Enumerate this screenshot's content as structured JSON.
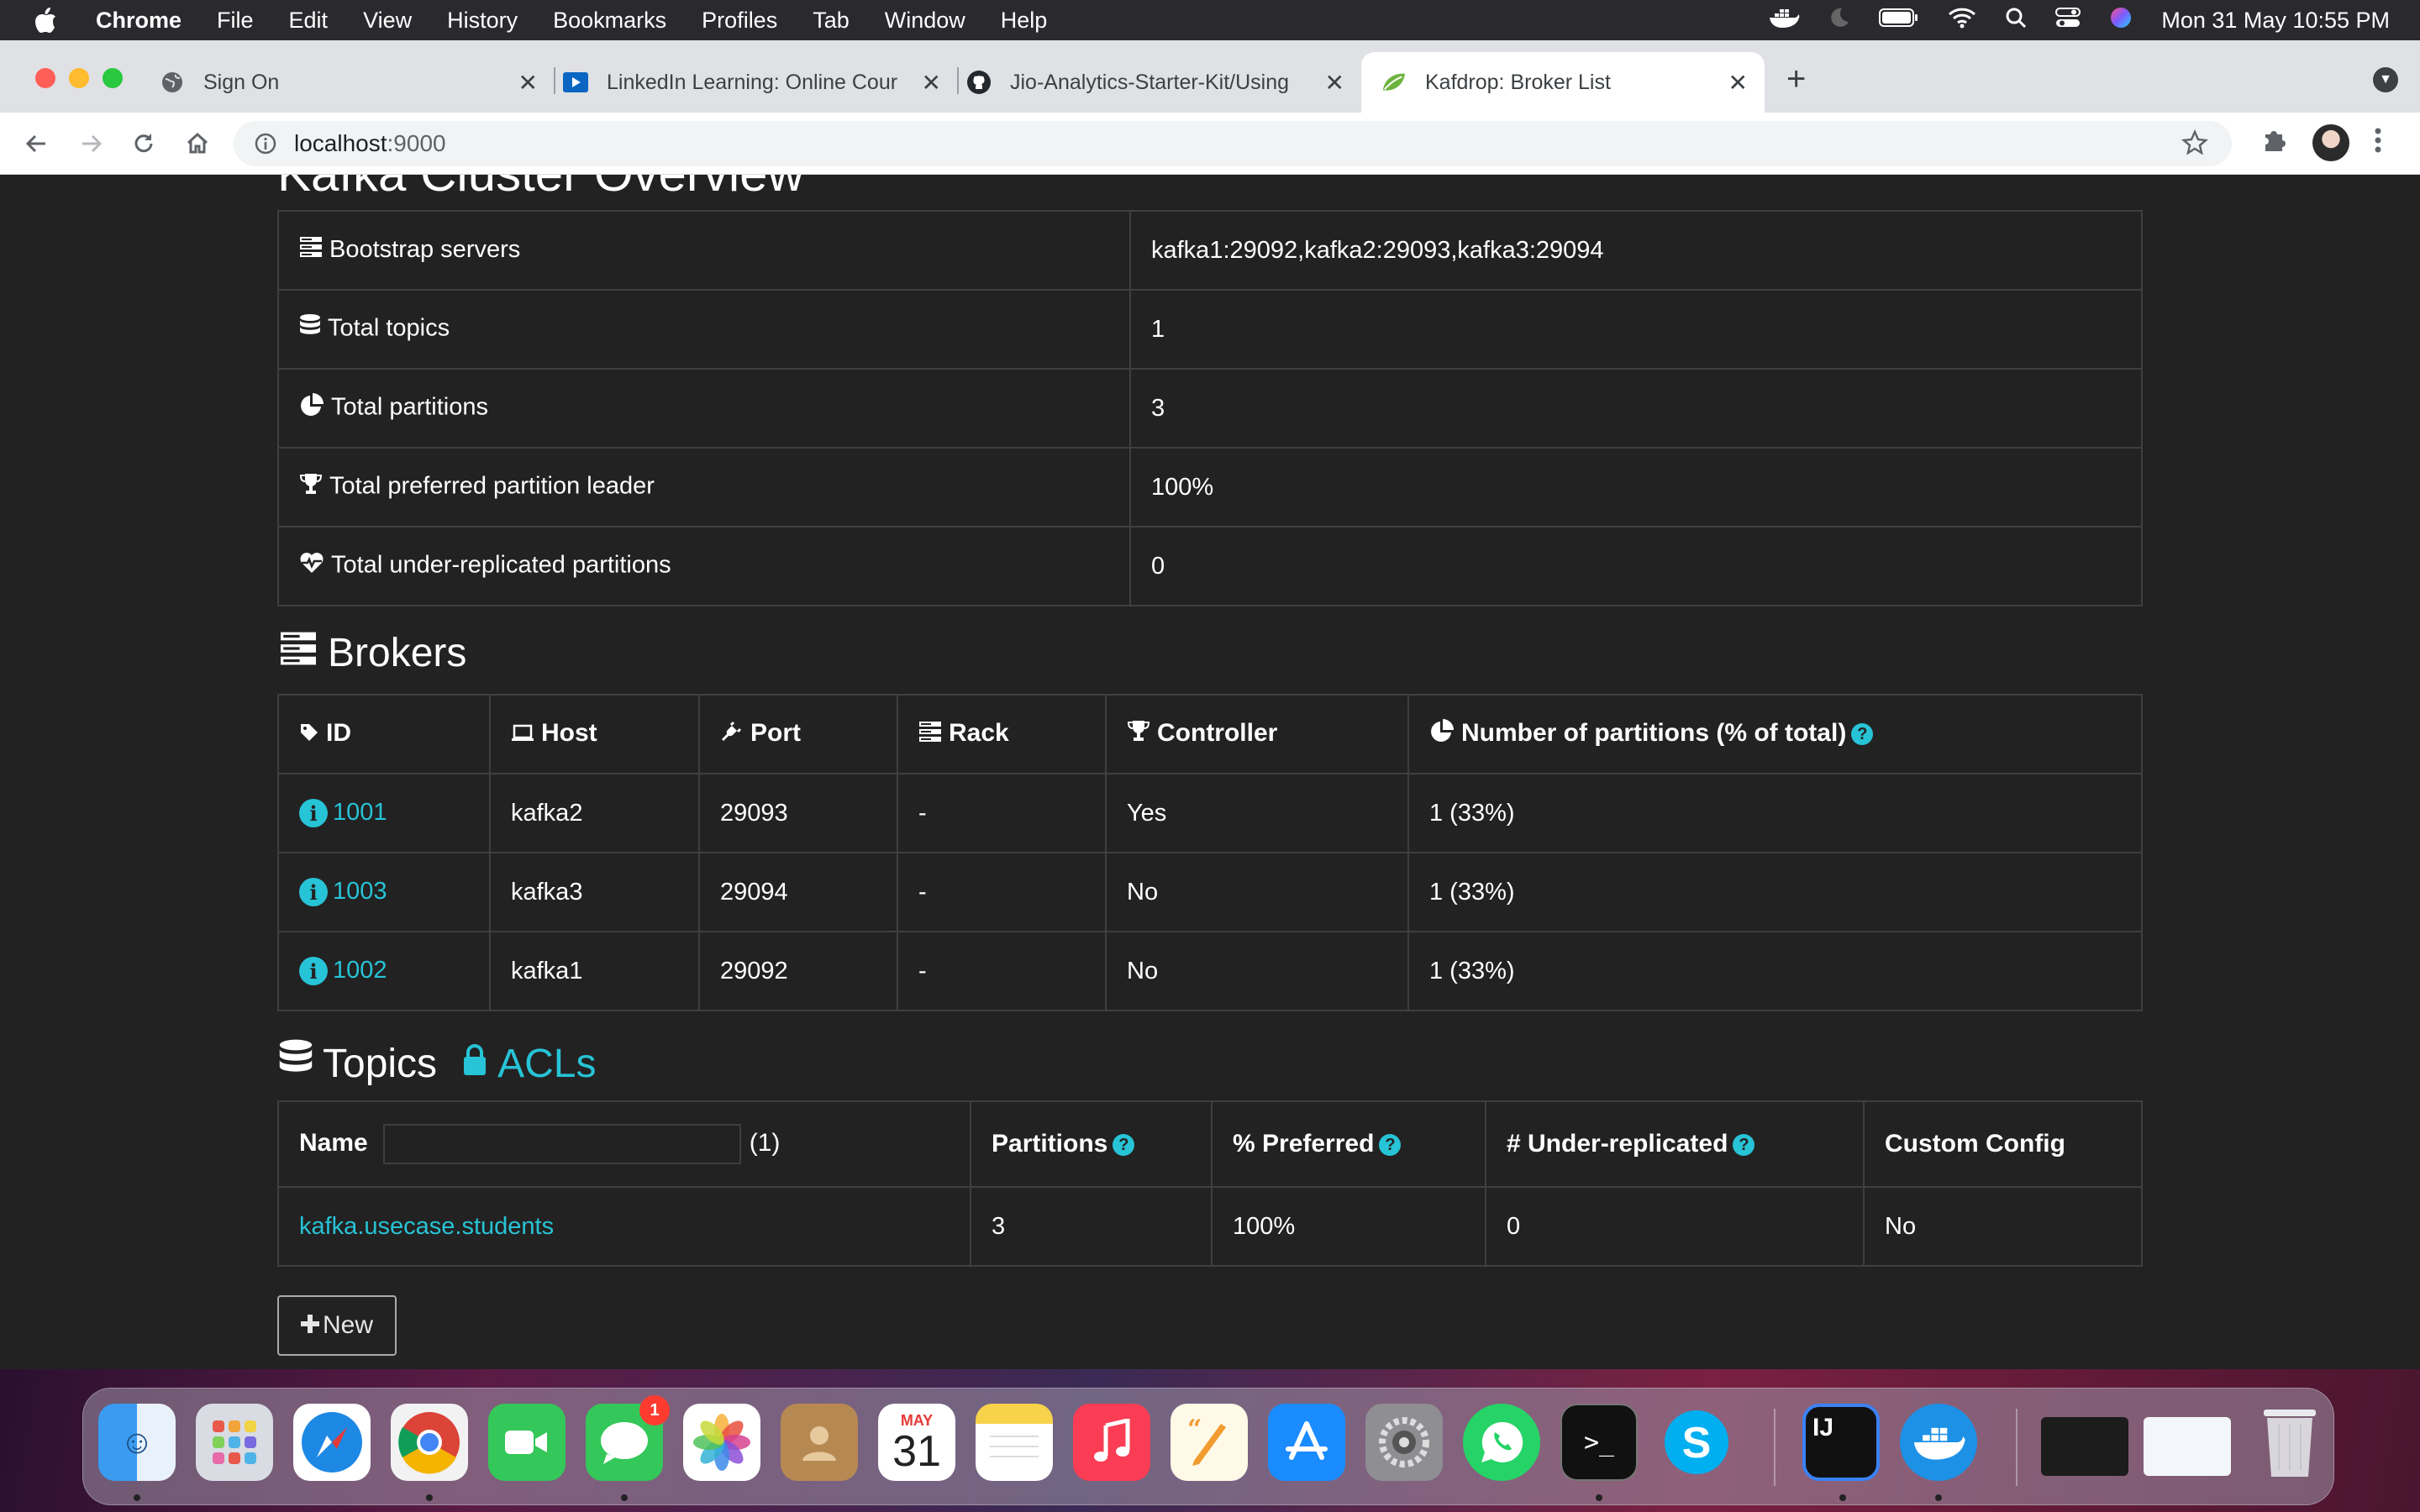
{
  "menubar": {
    "app_name": "Chrome",
    "items": [
      "File",
      "Edit",
      "View",
      "History",
      "Bookmarks",
      "Profiles",
      "Tab",
      "Window",
      "Help"
    ],
    "datetime": "Mon 31 May  10:55 PM"
  },
  "tabs": [
    {
      "title": "Sign On",
      "icon": "globe-icon"
    },
    {
      "title": "LinkedIn Learning: Online Cour",
      "icon": "linkedin-learning-icon"
    },
    {
      "title": "Jio-Analytics-Starter-Kit/Using",
      "icon": "github-icon"
    },
    {
      "title": "Kafdrop: Broker List",
      "icon": "kafdrop-leaf-icon",
      "active": true
    }
  ],
  "address_bar": {
    "host": "localhost",
    "port": ":9000"
  },
  "page": {
    "heading": "Kafka Cluster Overview",
    "overview": [
      {
        "label": "Bootstrap servers",
        "icon": "server-icon",
        "value": "kafka1:29092,kafka2:29093,kafka3:29094"
      },
      {
        "label": "Total topics",
        "icon": "database-icon",
        "value": "1"
      },
      {
        "label": "Total partitions",
        "icon": "pie-chart-icon",
        "value": "3"
      },
      {
        "label": "Total preferred partition leader",
        "icon": "trophy-icon",
        "value": "100%"
      },
      {
        "label": "Total under-replicated partitions",
        "icon": "heartbeat-icon",
        "value": "0"
      }
    ],
    "brokers": {
      "title": "Brokers",
      "headers": {
        "id": "ID",
        "host": "Host",
        "port": "Port",
        "rack": "Rack",
        "controller": "Controller",
        "partitions": "Number of partitions (% of total)"
      },
      "rows": [
        {
          "id": "1001",
          "host": "kafka2",
          "port": "29093",
          "rack": "-",
          "controller": "Yes",
          "partitions": "1 (33%)"
        },
        {
          "id": "1003",
          "host": "kafka3",
          "port": "29094",
          "rack": "-",
          "controller": "No",
          "partitions": "1 (33%)"
        },
        {
          "id": "1002",
          "host": "kafka1",
          "port": "29092",
          "rack": "-",
          "controller": "No",
          "partitions": "1 (33%)"
        }
      ]
    },
    "topics": {
      "title": "Topics",
      "acls_label": "ACLs",
      "headers": {
        "name": "Name",
        "count": "(1)",
        "partitions": "Partitions",
        "preferred": "% Preferred",
        "under_replicated": "# Under-replicated",
        "custom_config": "Custom Config"
      },
      "filter_value": "",
      "rows": [
        {
          "name": "kafka.usecase.students",
          "partitions": "3",
          "preferred": "100%",
          "under_replicated": "0",
          "custom_config": "No"
        }
      ]
    },
    "new_button": "New"
  },
  "dock": {
    "calendar_month": "MAY",
    "calendar_day": "31",
    "messages_badge": "1",
    "intellij_label": "IJ"
  },
  "colors": {
    "link": "#27c3d6",
    "page_bg": "#222222",
    "border": "#3f3f3f"
  }
}
